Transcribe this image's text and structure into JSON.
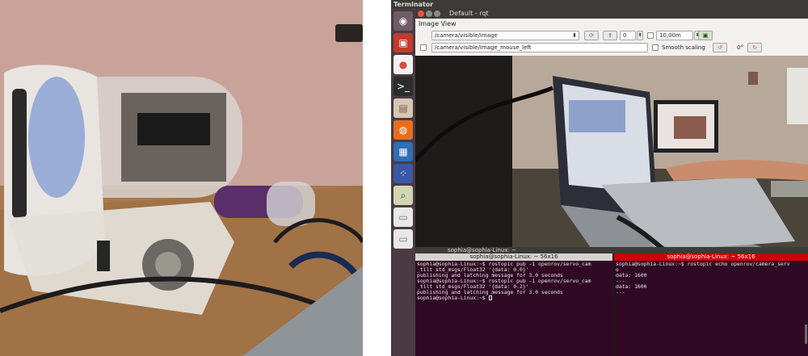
{
  "screen": {
    "topbar_title": "Terminator",
    "rqt": {
      "window_title": "Default - rqt",
      "dock_title": "Image View",
      "topic_value": "/camera/visible/image",
      "rotation_value": "0",
      "max_range_value": "10,00m",
      "mouse_topic_value": "/camera/visible/image_mouse_left",
      "smooth_scaling_label": "Smooth scaling",
      "angle_label": "0°"
    },
    "terminal_left": {
      "title": "sophia@sophia-Linux: ~ 56x16",
      "lines": [
        "sophia@sophia-Linux:~$ rostopic pub -1 openrov/servo_cam",
        "_tilt std_msgs/Float32 '{data: 0.0}'",
        "publishing and latching message for 3.0 seconds",
        "sophia@sophia-Linux:~$ rostopic pub -1 openrov/servo_cam",
        "_tilt std_msgs/Float32 '{data: 0.2}'",
        "publishing and latching message for 3.0 seconds",
        "sophia@sophia-Linux:~$ "
      ]
    },
    "terminal_right": {
      "title": "sophia@sophia-Linux: ~ 56x16",
      "lines": [
        "sophia@sophia-Linux:~$ rostopic echo openrov/camera_serv",
        "o",
        "data: 1600",
        "---",
        "data: 1600",
        "---"
      ]
    },
    "window_title_outer": "sophia@sophia-Linux: ~",
    "colors": {
      "terminal_bg": "#300a24",
      "active_header": "#cc0000",
      "panel": "#3c3b37",
      "launcher": "#4a3b42"
    }
  }
}
